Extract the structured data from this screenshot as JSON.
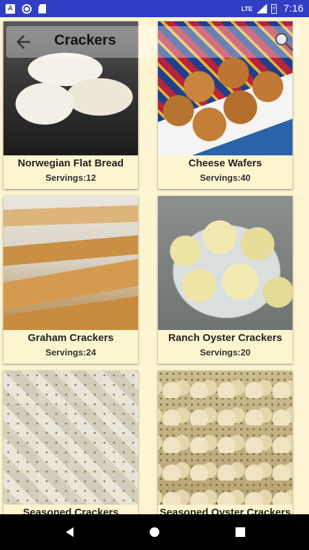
{
  "status_bar": {
    "time": "7:16",
    "network": "LTE",
    "icons": [
      "a-icon",
      "circle-icon",
      "sd-card-icon",
      "signal-icon",
      "battery-charging-icon"
    ]
  },
  "toolbar": {
    "title": "Crackers",
    "back_icon": "arrow-left-icon",
    "search_icon": "search-icon"
  },
  "recipes": [
    {
      "title": "Norwegian Flat Bread",
      "servings": "Servings:12"
    },
    {
      "title": "Cheese Wafers",
      "servings": "Servings:40"
    },
    {
      "title": "Graham Crackers",
      "servings": "Servings:24"
    },
    {
      "title": "Ranch Oyster Crackers",
      "servings": "Servings:20"
    },
    {
      "title": "Seasoned Crackers",
      "servings": ""
    },
    {
      "title": "Seasoned Oyster Crackers",
      "servings": ""
    }
  ],
  "nav_bar": {
    "back_icon": "triangle-back-icon",
    "home_icon": "circle-home-icon",
    "recent_icon": "square-recent-icon"
  },
  "colors": {
    "status_bar": "#2f3ec4",
    "background": "#fdf5d2",
    "nav_bar": "#000000"
  }
}
